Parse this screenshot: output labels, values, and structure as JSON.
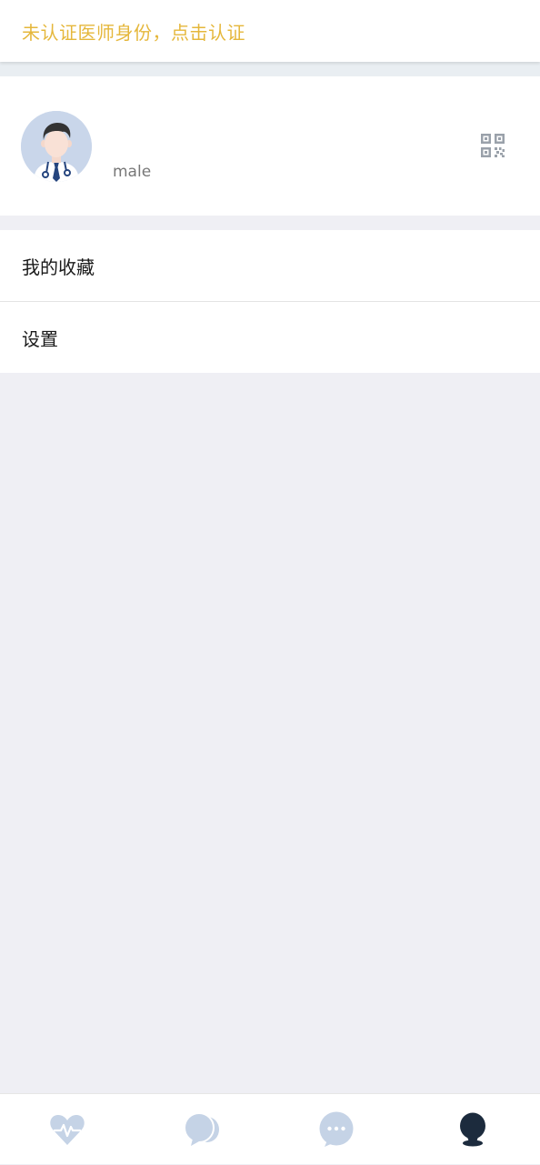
{
  "banner": {
    "text": "未认证医师身份，点击认证",
    "color": "#e5b73b"
  },
  "profile": {
    "avatar_icon": "doctor-avatar-icon",
    "gender": "male",
    "qr_icon": "qr-code-icon"
  },
  "menu": {
    "items": [
      {
        "label": "我的收藏"
      },
      {
        "label": "设置"
      }
    ]
  },
  "tabbar": {
    "tabs": [
      {
        "icon": "heart-pulse-icon",
        "active": false
      },
      {
        "icon": "chat-bubbles-icon",
        "active": false
      },
      {
        "icon": "message-dots-icon",
        "active": false
      },
      {
        "icon": "user-profile-icon",
        "active": true
      }
    ],
    "inactive_color": "#c5d3e6",
    "active_color": "#1c2b3d"
  }
}
